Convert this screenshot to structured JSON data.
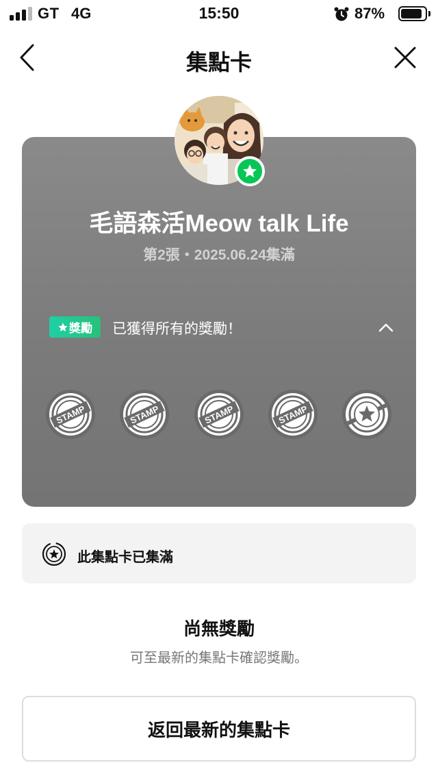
{
  "status_bar": {
    "carrier": "GT",
    "network": "4G",
    "time": "15:50",
    "battery": "87%",
    "battery_level": 0.87,
    "icons": [
      "signal-icon",
      "alarm-icon",
      "battery-icon"
    ]
  },
  "nav": {
    "title": "集點卡",
    "back_icon": "chevron-left-icon",
    "close_icon": "close-icon"
  },
  "card": {
    "title": "毛語森活Meow talk Life",
    "subtitle": "第2張・2025.06.24集滿",
    "reward_badge": "獎勵",
    "reward_status": "已獲得所有的獎勵！",
    "stamp_label": "STAMP",
    "stamps": [
      "stamp",
      "stamp",
      "stamp",
      "stamp",
      "star-stamp"
    ]
  },
  "full_banner": {
    "text": "此集點卡已集滿"
  },
  "no_reward": {
    "title": "尚無獎勵",
    "description": "可至最新的集點卡確認獎勵。"
  },
  "button": {
    "label": "返回最新的集點卡"
  },
  "colors": {
    "accent_green": "#06c755",
    "badge_teal": "#1fd0a6",
    "card_gray": "#808080"
  }
}
